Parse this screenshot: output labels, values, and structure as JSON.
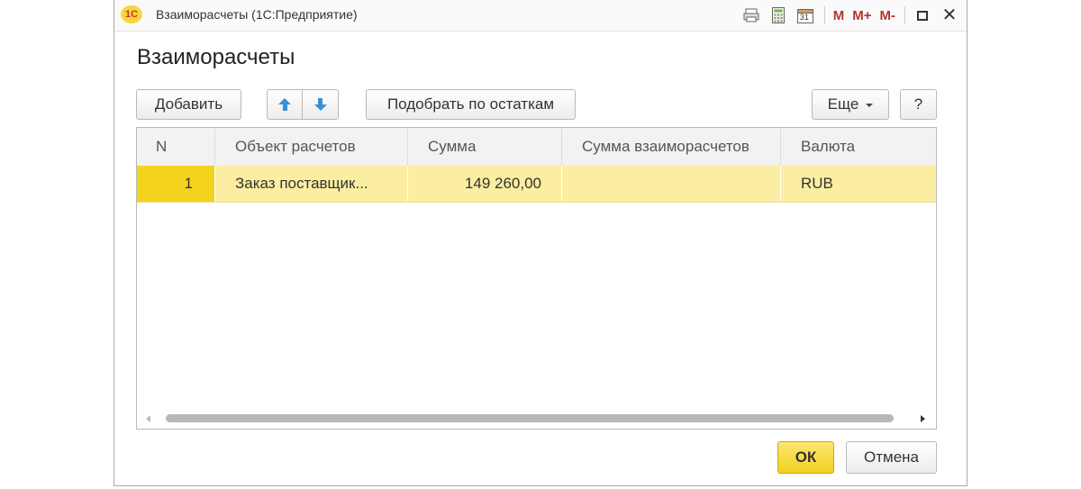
{
  "window": {
    "title": "Взаиморасчеты  (1С:Предприятие)",
    "logo_text": "1С",
    "controls": {
      "m_label": "M",
      "mplus_label": "M+",
      "mminus_label": "M-",
      "close_label": "✕",
      "calendar_label": "31"
    }
  },
  "form": {
    "title": "Взаиморасчеты"
  },
  "toolbar": {
    "add_label": "Добавить",
    "pick_label": "Подобрать по остаткам",
    "more_label": "Еще",
    "help_label": "?"
  },
  "table": {
    "columns": [
      "N",
      "Объект расчетов",
      "Сумма",
      "Сумма взаиморасчетов",
      "Валюта"
    ],
    "rows": [
      {
        "n": "1",
        "object": "Заказ поставщик...",
        "sum": "149 260,00",
        "mutual_sum": "",
        "currency": "RUB"
      }
    ]
  },
  "footer": {
    "ok_label": "ОК",
    "cancel_label": "Отмена"
  },
  "colors": {
    "selected_row": "#fbeea1",
    "selected_cell": "#f4d31c",
    "ok_button": "#f2cf1e",
    "arrow_blue": "#3b8fd6"
  }
}
